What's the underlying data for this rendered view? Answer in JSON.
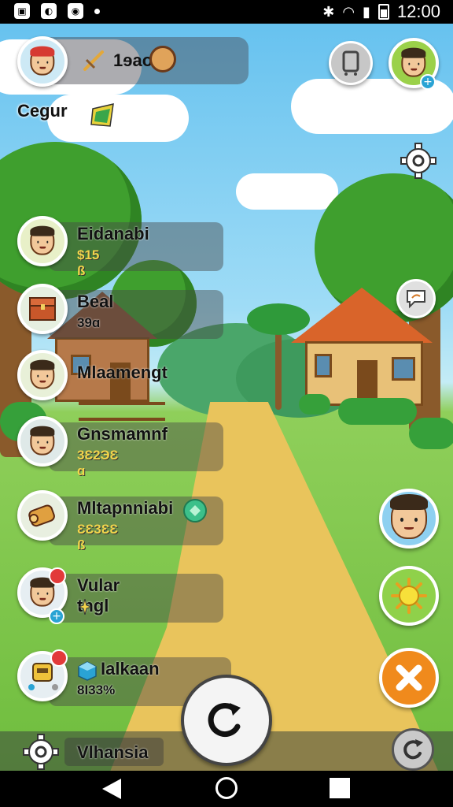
{
  "status_bar": {
    "time": "12:00"
  },
  "profile": {
    "name": "Cegur",
    "score": "1ɘao"
  },
  "players": [
    {
      "name": "Eidanabi",
      "value": "$15 ß"
    },
    {
      "name": "Beal",
      "value": "39ɑ"
    },
    {
      "name": "Mlaamengt",
      "value": ""
    },
    {
      "name": "Gnsmamnf",
      "value": "3Ɛ2ЭƐ ɑ"
    },
    {
      "name": "Mltapnniabi",
      "value": "ƐƐ3ƐƐ ß"
    },
    {
      "name": "Vular tngl",
      "value": ""
    },
    {
      "name": "Ialkaan",
      "value": "8Ɩ33%"
    }
  ],
  "bottom_bar": {
    "label": "Vlhansia"
  },
  "colors": {
    "sky": "#67c2ef",
    "grass": "#6fbd3e",
    "path": "#e9c45c",
    "value_gold": "#f3d54c",
    "close_orange": "#f08a1c",
    "sun_green": "#8fd14a",
    "portrait_blue": "#8ed0f0"
  }
}
